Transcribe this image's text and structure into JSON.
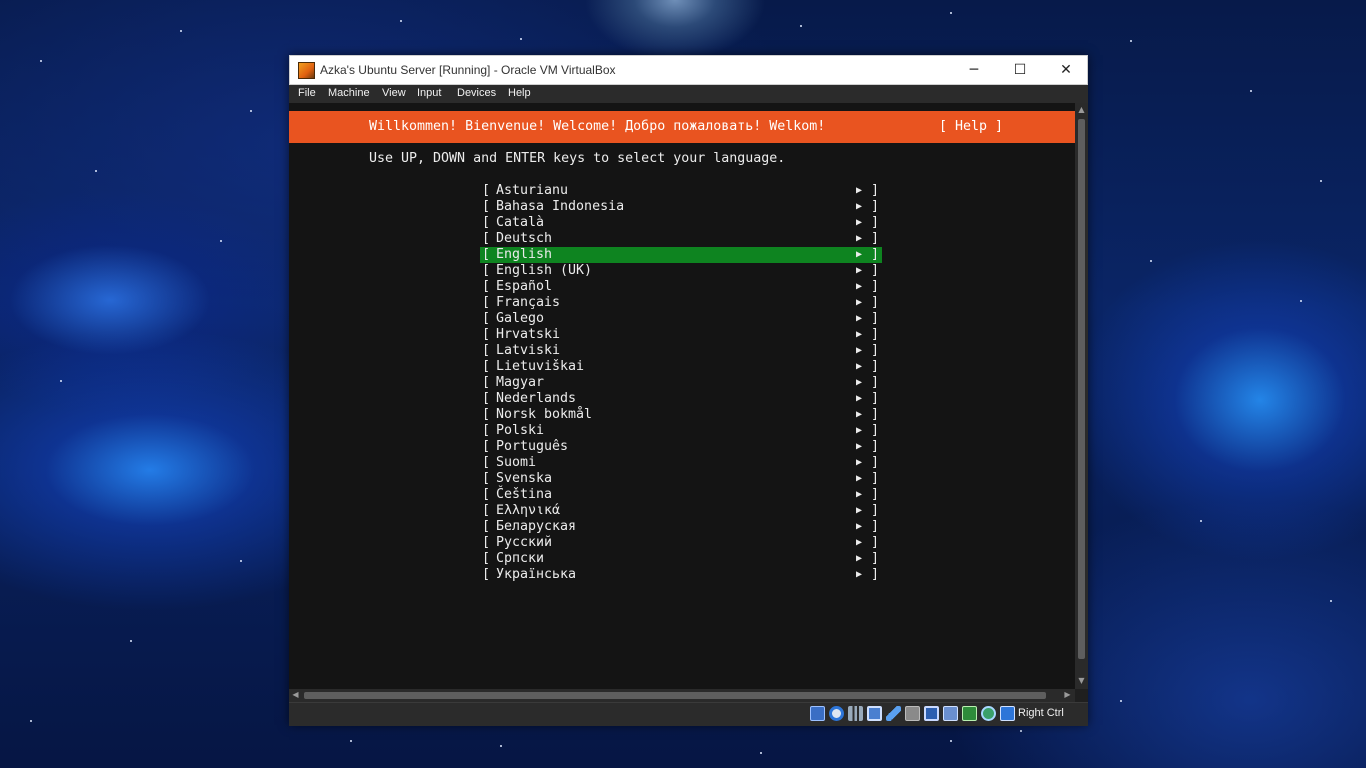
{
  "window": {
    "title": "Azka's Ubuntu Server [Running] - Oracle VM VirtualBox",
    "minimize": "─",
    "maximize": "☐",
    "close": "✕"
  },
  "menu": [
    "File",
    "Machine",
    "View",
    "Input",
    "Devices",
    "Help"
  ],
  "installer": {
    "banner": "Willkommen! Bienvenue! Welcome! Добро пожаловать! Welkom!",
    "help": "[ Help ]",
    "instruction": "Use UP, DOWN and ENTER keys to select your language.",
    "selected_language": "English",
    "languages": [
      "Asturianu",
      "Bahasa Indonesia",
      "Català",
      "Deutsch",
      "English",
      "English (UK)",
      "Español",
      "Français",
      "Galego",
      "Hrvatski",
      "Latviski",
      "Lietuviškai",
      "Magyar",
      "Nederlands",
      "Norsk bokmål",
      "Polski",
      "Português",
      "Suomi",
      "Svenska",
      "Čeština",
      "Ελληνικά",
      "Беларуская",
      "Русский",
      "Српски",
      "Українська"
    ],
    "row_open": "[",
    "row_arrow": "▶",
    "row_close": "]"
  },
  "status_bar": {
    "icons": [
      "hard-disk-icon",
      "optical-drive-icon",
      "audio-icon",
      "network-icon",
      "usb-icon",
      "shared-folders-icon",
      "display-icon",
      "video-capture-icon",
      "cpu-icon",
      "mouse-integration-icon",
      "keyboard-capture-icon"
    ],
    "host_key": "Right Ctrl"
  },
  "colors": {
    "banner": "#e95420",
    "selection": "#0e8420",
    "terminal_bg": "#141414",
    "terminal_text": "#ececec"
  }
}
